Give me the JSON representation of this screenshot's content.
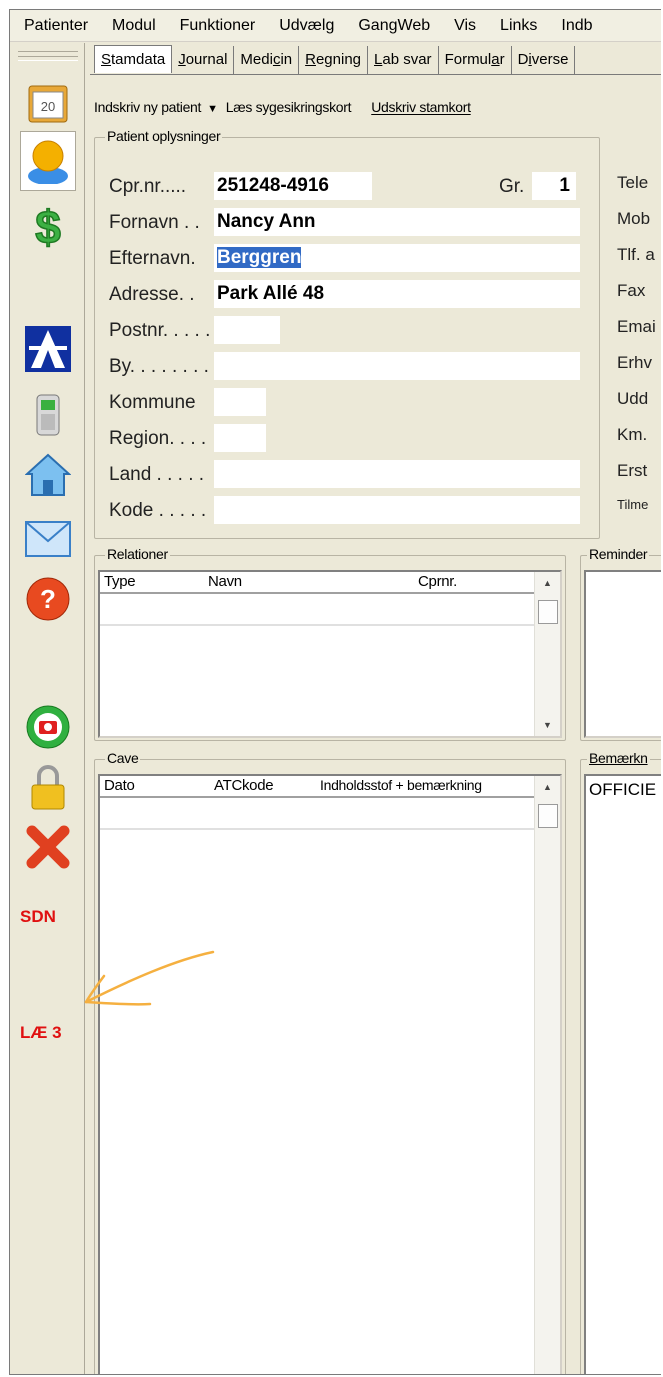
{
  "menubar": [
    "Patienter",
    "Modul",
    "Funktioner",
    "Udvælg",
    "GangWeb",
    "Vis",
    "Links",
    "Indb"
  ],
  "sidebar": {
    "calendar_day": "20",
    "label_sdn": "SDN",
    "label_lae": "LÆ 3"
  },
  "tabs": [
    {
      "pre": "",
      "u": "S",
      "post": "tamdata"
    },
    {
      "pre": "",
      "u": "J",
      "post": "ournal"
    },
    {
      "pre": "Medi",
      "u": "c",
      "post": "in"
    },
    {
      "pre": "",
      "u": "R",
      "post": "egning"
    },
    {
      "pre": "",
      "u": "L",
      "post": "ab svar"
    },
    {
      "pre": "Formul",
      "u": "a",
      "post": "r"
    },
    {
      "pre": "D",
      "u": "i",
      "post": "verse"
    }
  ],
  "toolbar": {
    "register": "Indskriv ny patient",
    "read_card": "Læs sygesikringskort",
    "print_card": "Udskriv stamkort"
  },
  "patient": {
    "group_title": "Patient oplysninger",
    "labels": {
      "cpr": "Cpr.nr.....",
      "group": "Gr.",
      "first": "Fornavn . .",
      "last": "Efternavn.",
      "address": "Adresse. .",
      "postnr": "Postnr. . . . .",
      "city": "By. . . . . . . . .",
      "municipality": "Kommune",
      "region": "Region. . . .",
      "country": "Land . . . . .",
      "code": "Kode . . . . ."
    },
    "values": {
      "cpr": "251248-4916",
      "group": "1",
      "first": "Nancy Ann",
      "last": "Berggren",
      "address": "Park Allé 48"
    },
    "right_labels": [
      "Tele",
      "Mob",
      "Tlf. a",
      "Fax",
      "Emai",
      "Erhv",
      "Udd",
      "Km.",
      "Erst",
      "Tilme"
    ]
  },
  "relations": {
    "title": "Relationer",
    "columns": [
      "Type",
      "Navn",
      "Cprnr."
    ]
  },
  "reminder": {
    "title": "Reminder"
  },
  "cave": {
    "title": "Cave",
    "columns": [
      "Dato",
      "ATCkode",
      "Indholdsstof + bemærkning"
    ]
  },
  "notes": {
    "title": "Bemærkn",
    "text": "OFFICIE"
  },
  "colors": {
    "annotation_arrow": "#f5b040",
    "sidebar_text": "#e01010"
  }
}
